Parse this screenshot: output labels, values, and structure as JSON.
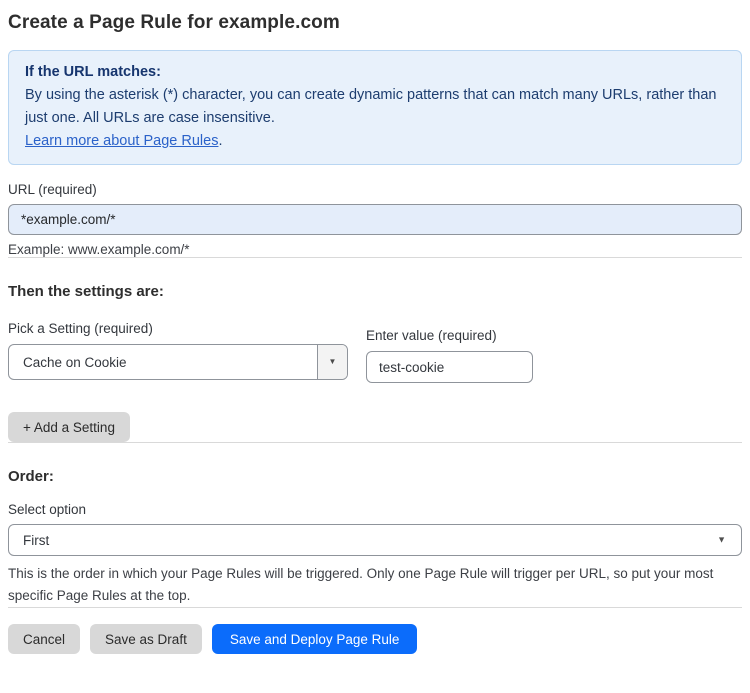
{
  "page": {
    "title": "Create a Page Rule for example.com"
  },
  "info_box": {
    "heading": "If the URL matches:",
    "body": "By using the asterisk (*) character, you can create dynamic patterns that can match many URLs, rather than just one. All URLs are case insensitive.",
    "link_label": "Learn more about Page Rules",
    "link_suffix": "."
  },
  "url_field": {
    "label": "URL (required)",
    "value": "*example.com/*",
    "helper": "Example: www.example.com/*"
  },
  "settings_section": {
    "heading": "Then the settings are:",
    "setting_label": "Pick a Setting (required)",
    "setting_value": "Cache on Cookie",
    "value_label": "Enter value (required)",
    "value_value": "test-cookie",
    "add_button_label": "+ Add a Setting"
  },
  "order_section": {
    "heading": "Order:",
    "select_label": "Select option",
    "select_value": "First",
    "help_text": "This is the order in which your Page Rules will be triggered. Only one Page Rule will trigger per URL, so put your most specific Page Rules at the top."
  },
  "footer": {
    "cancel_label": "Cancel",
    "save_draft_label": "Save as Draft",
    "deploy_label": "Save and Deploy Page Rule"
  },
  "icons": {
    "dropdown_caret": "▼"
  },
  "colors": {
    "info_box_background": "#e8f1fb",
    "info_box_border": "#b9d6f2",
    "info_text": "#1d3d6f",
    "link_blue": "#2b62c9",
    "url_input_background": "#e4edfa",
    "input_border": "#8f949b",
    "gray_button": "#d8d8d8",
    "primary_button": "#0b6cfb",
    "divider": "#d9d9d9"
  }
}
